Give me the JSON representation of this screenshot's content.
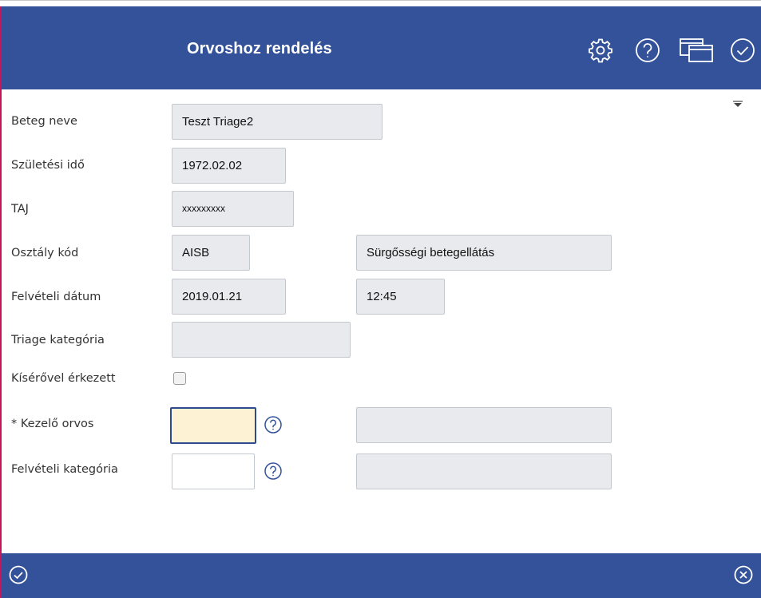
{
  "header": {
    "title": "Orvoshoz rendelés",
    "icons": [
      "gear-icon",
      "help-icon",
      "windows-icon",
      "check-circle-icon"
    ],
    "background": "#34529a"
  },
  "form": {
    "patient_name": {
      "label": "Beteg neve",
      "value": "Teszt Triage2"
    },
    "birth_date": {
      "label": "Születési idő",
      "value": "1972.02.02"
    },
    "taj": {
      "label": "TAJ",
      "value": "xxxxxxxxx"
    },
    "department": {
      "label": "Osztály kód",
      "code": "AISB",
      "name": "Sürgősségi betegellátás"
    },
    "admission_date": {
      "label": "Felvételi dátum",
      "date": "2019.01.21",
      "time": "12:45"
    },
    "triage_category": {
      "label": "Triage kategória",
      "value": ""
    },
    "escorted": {
      "label": "Kísérővel érkezett",
      "checked": false
    },
    "attending_doctor": {
      "label": "* Kezelő orvos",
      "value": "",
      "description": ""
    },
    "admission_category": {
      "label": "Felvételi kategória",
      "value": "",
      "description": ""
    }
  },
  "footer": {
    "icons": [
      "check-circle-icon",
      "close-circle-icon"
    ]
  },
  "colors": {
    "accent": "#34529a",
    "active_field": "#fdf3d4",
    "readonly_field": "#e8eaee",
    "left_border": "#c2185b"
  }
}
